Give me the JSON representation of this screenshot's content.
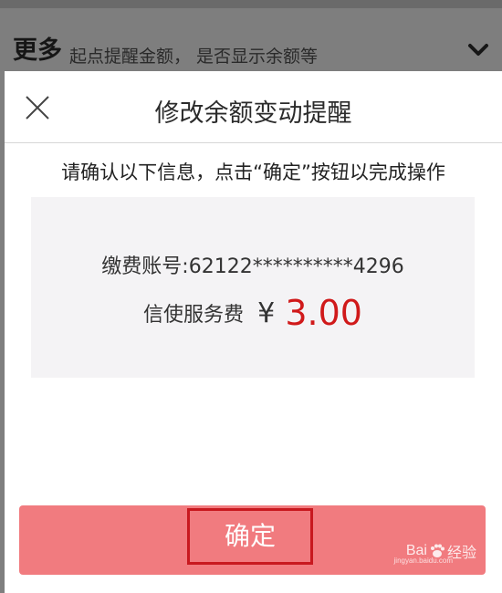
{
  "background": {
    "more_title": "更多",
    "more_subtitle": "起点提醒金额，  是否显示余额等",
    "chevron_icon": "chevron-down-icon"
  },
  "dialog": {
    "close_icon": "close-icon",
    "title": "修改余额变动提醒",
    "instructions": "请确认以下信息，点击“确定”按钮以完成操作",
    "account_label": "缴费账号:",
    "account_value": "62122**********4296",
    "fee_label": "信使服务费",
    "currency_symbol": "¥",
    "fee_amount": "3.00",
    "confirm_label": "确定"
  },
  "watermark": {
    "brand": "Bai",
    "brand2": "经验",
    "sub": "jingyan.baidu.com"
  },
  "colors": {
    "overlay": "#7f7f7f",
    "confirm_button": "#f17b7f",
    "highlight_border": "#c8191f",
    "amount": "#d0191a"
  }
}
